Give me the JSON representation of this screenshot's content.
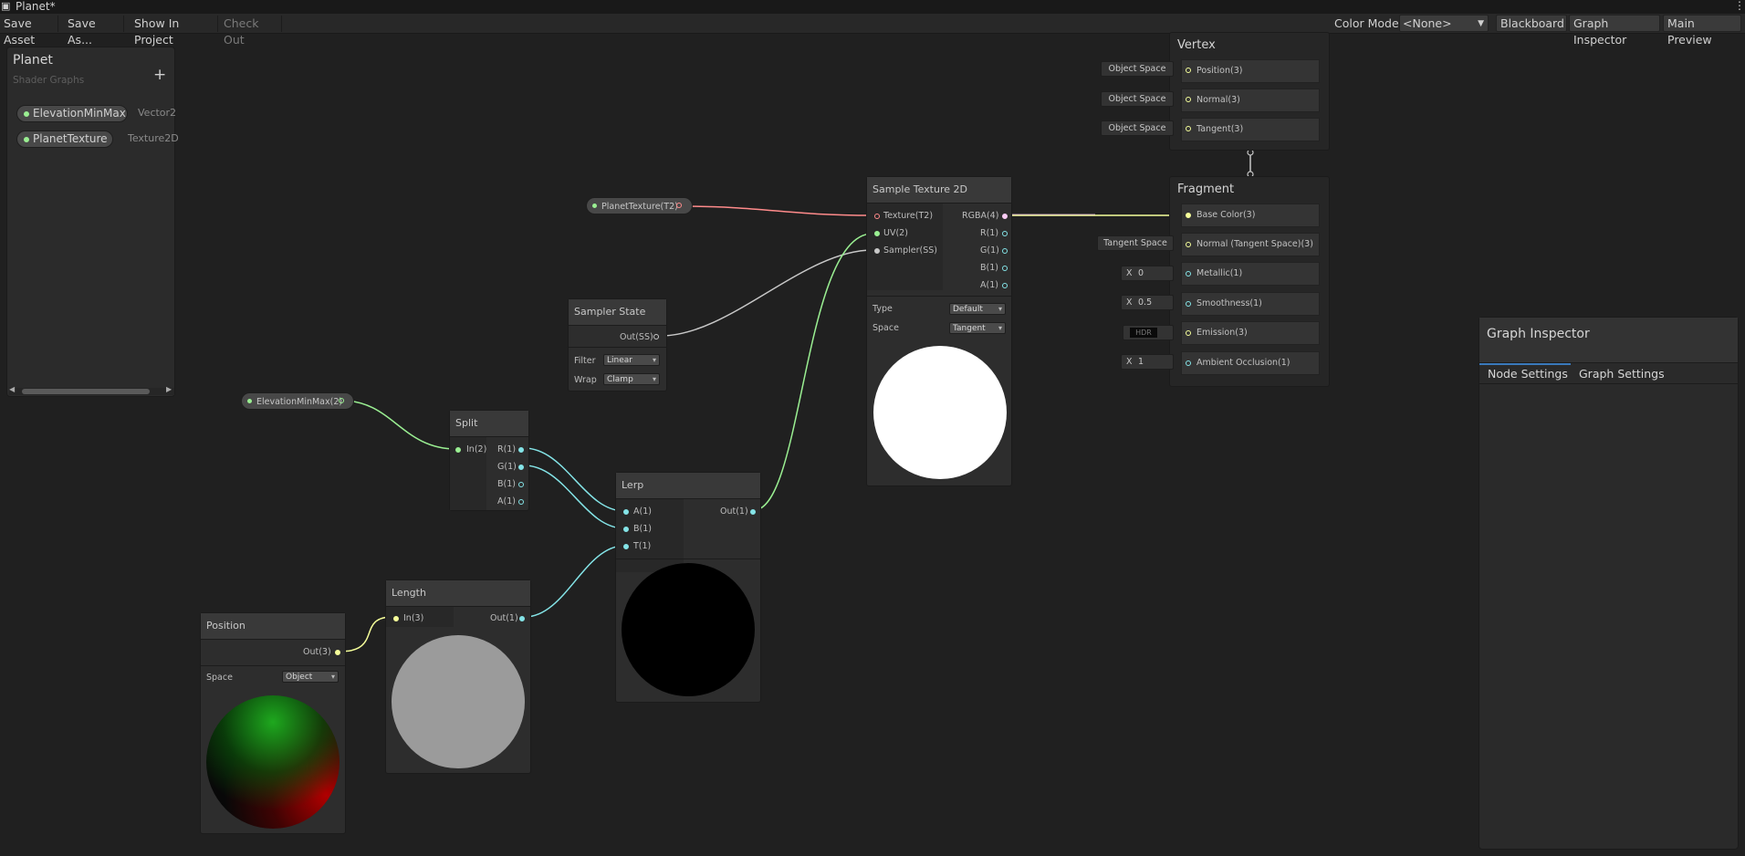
{
  "window": {
    "title": "Planet*"
  },
  "toolbar": {
    "save_asset": "Save Asset",
    "save_as": "Save As...",
    "show_in_project": "Show In Project",
    "check_out": "Check Out",
    "color_mode_label": "Color Mode",
    "color_mode_value": "<None>",
    "blackboard": "Blackboard",
    "graph_inspector": "Graph Inspector",
    "main_preview": "Main Preview"
  },
  "blackboard": {
    "title": "Planet",
    "subtitle": "Shader Graphs",
    "add": "+",
    "properties": [
      {
        "name": "ElevationMinMax",
        "type": "Vector2"
      },
      {
        "name": "PlanetTexture",
        "type": "Texture2D"
      }
    ]
  },
  "graph_inspector": {
    "title": "Graph Inspector",
    "tabs": [
      "Node Settings",
      "Graph Settings"
    ],
    "active_tab": "Node Settings"
  },
  "nodes": {
    "planet_texture_prop": {
      "label": "PlanetTexture(T2)"
    },
    "elevation_prop": {
      "label": "ElevationMinMax(2)"
    },
    "sampler_state": {
      "title": "Sampler State",
      "out": "Out(SS)",
      "filter_label": "Filter",
      "filter": "Linear",
      "wrap_label": "Wrap",
      "wrap": "Clamp"
    },
    "split": {
      "title": "Split",
      "in": "In(2)",
      "outs": [
        "R(1)",
        "G(1)",
        "B(1)",
        "A(1)"
      ]
    },
    "sample_texture": {
      "title": "Sample Texture 2D",
      "inputs": [
        "Texture(T2)",
        "UV(2)",
        "Sampler(SS)"
      ],
      "outputs": [
        "RGBA(4)",
        "R(1)",
        "G(1)",
        "B(1)",
        "A(1)"
      ],
      "type_label": "Type",
      "type": "Default",
      "space_label": "Space",
      "space": "Tangent"
    },
    "lerp": {
      "title": "Lerp",
      "inputs": [
        "A(1)",
        "B(1)",
        "T(1)"
      ],
      "out": "Out(1)"
    },
    "length": {
      "title": "Length",
      "in": "In(3)",
      "out": "Out(1)"
    },
    "position": {
      "title": "Position",
      "out": "Out(3)",
      "space_label": "Space",
      "space": "Object"
    }
  },
  "master": {
    "vertex": {
      "title": "Vertex",
      "slots": [
        {
          "label": "Position(3)",
          "input": "Object Space"
        },
        {
          "label": "Normal(3)",
          "input": "Object Space"
        },
        {
          "label": "Tangent(3)",
          "input": "Object Space"
        }
      ]
    },
    "fragment": {
      "title": "Fragment",
      "slots": [
        {
          "label": "Base Color(3)",
          "input": ""
        },
        {
          "label": "Normal (Tangent Space)(3)",
          "input": "Tangent Space"
        },
        {
          "label": "Metallic(1)",
          "x": "X",
          "input": "0"
        },
        {
          "label": "Smoothness(1)",
          "x": "X",
          "input": "0.5"
        },
        {
          "label": "Emission(3)",
          "input": "HDR"
        },
        {
          "label": "Ambient Occlusion(1)",
          "x": "X",
          "input": "1"
        }
      ]
    }
  },
  "colors": {
    "vector1": "#84e4e7",
    "vector2": "#9aef92",
    "vector3": "#f6ff9a",
    "vector4": "#fbcbf4",
    "texture": "#ff8b8b",
    "sampler": "#c8c8c8"
  }
}
